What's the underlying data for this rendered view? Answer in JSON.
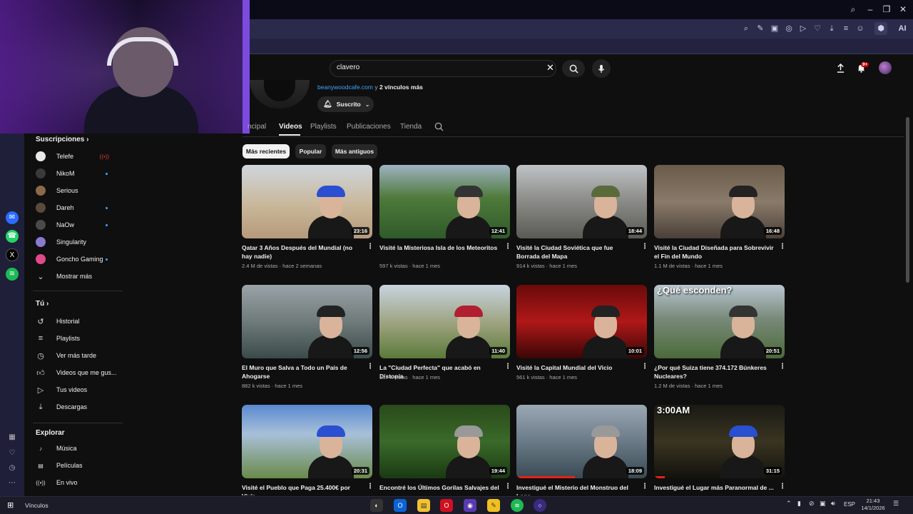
{
  "search": {
    "query": "clavero"
  },
  "notifications": {
    "badge": "9+"
  },
  "channel": {
    "links_link": "beanywoodcafe.com",
    "links_suffix": " y ",
    "links_more": "2 vínculos más",
    "subscribe_label": "Suscrito"
  },
  "channel_tabs": [
    "ncipal",
    "Videos",
    "Playlists",
    "Publicaciones",
    "Tienda"
  ],
  "chips": [
    "Más recientes",
    "Popular",
    "Más antiguos"
  ],
  "nav": {
    "subscriptions_title": "Suscripciones",
    "subscriptions": [
      {
        "label": "Telefe",
        "color": "#e9e9e9",
        "status": "live"
      },
      {
        "label": "NikoM",
        "color": "#3a3a3a",
        "status": "new"
      },
      {
        "label": "Serious",
        "color": "#8a6a4a",
        "status": ""
      },
      {
        "label": "Dareh",
        "color": "#5a4a3a",
        "status": "new"
      },
      {
        "label": "NaOw",
        "color": "#4a4a4a",
        "status": "new"
      },
      {
        "label": "Singularity",
        "color": "#8a7ad0",
        "status": ""
      },
      {
        "label": "Goncho Gaming",
        "color": "#e04a8a",
        "status": "new"
      }
    ],
    "show_more": "Mostrar más",
    "you_title": "Tú",
    "you_items": [
      "Historial",
      "Playlists",
      "Ver más tarde",
      "Videos que me gus...",
      "Tus videos",
      "Descargas"
    ],
    "explore_title": "Explorar",
    "explore_items": [
      "Música",
      "Películas",
      "En vivo"
    ]
  },
  "videos": [
    {
      "title": "Qatar 3 Años Después del Mundial (no hay nadie)",
      "meta": "2.4 M de vistas · hace 2 semanas",
      "duration": "23:16",
      "bg": "linear-gradient(180deg,#cfd6dd 0%,#c9b79a 55%,#b59a7a 100%)",
      "cap": "#2a4fd0"
    },
    {
      "title": "Visité la Misteriosa Isla de los Meteoritos",
      "meta": "597 k vistas · hace 1 mes",
      "duration": "12:41",
      "bg": "linear-gradient(180deg,#9fb2c2 0%,#4e7a3a 45%,#2f5a2a 100%)",
      "cap": "#333"
    },
    {
      "title": "Visité la Ciudad Soviética que fue Borrada del Mapa",
      "meta": "914 k vistas · hace 1 mes",
      "duration": "18:44",
      "bg": "linear-gradient(180deg,#bfc3c6 0%,#8a8a86 50%,#5a5a55 100%)",
      "cap": "#5a6a3a"
    },
    {
      "title": "Visité la Ciudad Diseñada para Sobrevivir el Fin del Mundo",
      "meta": "1.1 M de vistas · hace 1 mes",
      "duration": "16:48",
      "bg": "linear-gradient(180deg,#6a5a4a 0%,#8a7a6a 50%,#4a4038 100%)",
      "cap": "#222"
    },
    {
      "title": "El Muro que Salva a Todo un País de Ahogarse",
      "meta": "882 k vistas · hace 1 mes",
      "duration": "12:56",
      "bg": "linear-gradient(180deg,#9aa3a8 0%,#6f7a7a 50%,#3a4a4a 100%)",
      "cap": "#222"
    },
    {
      "title": "La \"Ciudad Perfecta\" que acabó en Distopía",
      "meta": "567 k vistas · hace 1 mes",
      "duration": "11:40",
      "bg": "linear-gradient(180deg,#c7d4e0 0%,#9aa07a 55%,#5a7a3a 100%)",
      "cap": "#b02030"
    },
    {
      "title": "Visité la Capital Mundial del Vicio",
      "meta": "561 k vistas · hace 1 mes",
      "duration": "10:01",
      "bg": "linear-gradient(180deg,#6a0a0a 0%,#b01818 50%,#3a0606 100%)",
      "cap": "#222"
    },
    {
      "title": "¿Por qué Suiza tiene 374.172 Búnkeres Nucleares?",
      "meta": "1.2 M de vistas · hace 1 mes",
      "duration": "20:51",
      "overlay": "¿Qué esconden?",
      "bg": "linear-gradient(180deg,#b8c6d2 0%,#7a8a7a 45%,#4a6a3a 100%)",
      "cap": "#333"
    },
    {
      "title": "Visité el Pueblo que Paga 25.400€ por Vivir ...",
      "meta": "",
      "duration": "20:31",
      "bg": "linear-gradient(180deg,#5a8ad0 0%,#a8c0d8 40%,#6a8a4a 100%)",
      "cap": "#2a4fd0"
    },
    {
      "title": "Encontré los Últimos Gorilas Salvajes del ...",
      "meta": "",
      "duration": "19:44",
      "bg": "linear-gradient(180deg,#2a4a1a 0%,#3a6a2a 50%,#1a3a12 100%)",
      "cap": "#999"
    },
    {
      "title": "Investigué el Misterio del Monstruo del Lago ...",
      "meta": "",
      "duration": "18:09",
      "bg": "linear-gradient(180deg,#9aa8b4 0%,#6a7a86 50%,#3a4a55 100%)",
      "cap": "#999",
      "progress": 0.45
    },
    {
      "title": "Investigué el Lugar más Paranormal de ...",
      "meta": "",
      "duration": "31:15",
      "overlay": "3:00AM",
      "bg": "linear-gradient(180deg,#1a1a14 0%,#3a3422 50%,#12120c 100%)",
      "cap": "#2a4fd0",
      "progress": 0.08
    }
  ],
  "taskbar": {
    "label": "Vínculos",
    "lang": "ESP",
    "time": "21:43",
    "date": "14/1/2026"
  },
  "browser": {
    "ai_label": "AI"
  }
}
